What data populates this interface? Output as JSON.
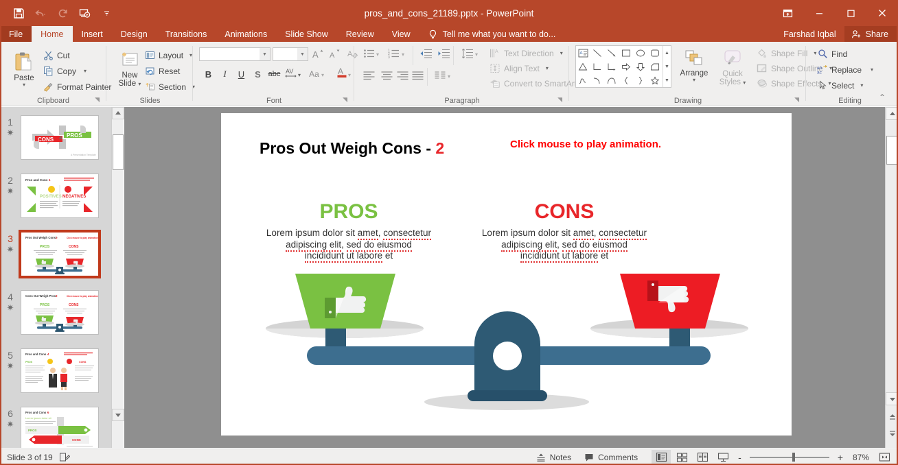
{
  "window": {
    "title": "pros_and_cons_21189.pptx - PowerPoint",
    "user": "Farshad Iqbal",
    "share_label": "Share",
    "qat": [
      {
        "name": "save-icon",
        "label": "Save"
      },
      {
        "name": "undo-icon",
        "label": "Undo"
      },
      {
        "name": "redo-icon",
        "label": "Redo"
      },
      {
        "name": "start-from-beginning-icon",
        "label": "Start From Beginning"
      },
      {
        "name": "customize-qat-icon",
        "label": "Customize Quick Access Toolbar"
      }
    ],
    "controls": [
      {
        "name": "ribbon-display-options",
        "label": "Ribbon Display Options"
      },
      {
        "name": "minimize",
        "label": "Minimize"
      },
      {
        "name": "restore",
        "label": "Restore Down"
      },
      {
        "name": "close",
        "label": "Close"
      }
    ]
  },
  "ribbon": {
    "tabs": [
      {
        "label": "File",
        "active": false,
        "file": true
      },
      {
        "label": "Home",
        "active": true,
        "file": false
      },
      {
        "label": "Insert",
        "active": false,
        "file": false
      },
      {
        "label": "Design",
        "active": false,
        "file": false
      },
      {
        "label": "Transitions",
        "active": false,
        "file": false
      },
      {
        "label": "Animations",
        "active": false,
        "file": false
      },
      {
        "label": "Slide Show",
        "active": false,
        "file": false
      },
      {
        "label": "Review",
        "active": false,
        "file": false
      },
      {
        "label": "View",
        "active": false,
        "file": false
      }
    ],
    "tellme": "Tell me what you want to do...",
    "groups": {
      "clipboard": {
        "label": "Clipboard",
        "paste": "Paste",
        "cut": "Cut",
        "copy": "Copy",
        "format_painter": "Format Painter"
      },
      "slides": {
        "label": "Slides",
        "new_slide": "New\nSlide",
        "new_slide_line1": "New",
        "new_slide_line2": "Slide",
        "layout": "Layout",
        "reset": "Reset",
        "section": "Section"
      },
      "font": {
        "label": "Font",
        "font_name_value": "",
        "font_size_value": "",
        "grow_font": "A",
        "shrink_font": "A",
        "clear_formatting": "Clear All Formatting",
        "bold": "B",
        "italic": "I",
        "underline": "U",
        "shadow": "S",
        "strikethrough": "abc",
        "character_spacing": "AV",
        "change_case": "Aa",
        "font_color": "A"
      },
      "paragraph": {
        "label": "Paragraph",
        "text_direction": "Text Direction",
        "align_text": "Align Text",
        "convert_to_smartart": "Convert to SmartArt"
      },
      "drawing": {
        "label": "Drawing",
        "arrange": "Arrange",
        "quick_styles_line1": "Quick",
        "quick_styles_line2": "Styles",
        "shape_fill": "Shape Fill",
        "shape_outline": "Shape Outline",
        "shape_effects": "Shape Effects"
      },
      "editing": {
        "label": "Editing",
        "find": "Find",
        "replace": "Replace",
        "select": "Select"
      }
    }
  },
  "thumbnails": [
    {
      "number": "1",
      "selected": false,
      "kind": "cover"
    },
    {
      "number": "2",
      "selected": false,
      "kind": "positives-negatives"
    },
    {
      "number": "3",
      "selected": true,
      "kind": "scale"
    },
    {
      "number": "4",
      "selected": false,
      "kind": "scale"
    },
    {
      "number": "5",
      "selected": false,
      "kind": "people"
    },
    {
      "number": "6",
      "selected": false,
      "kind": "arrows"
    }
  ],
  "slide": {
    "title_text": "Pros Out Weigh Cons - ",
    "title_number": "2",
    "animation_note": "Click mouse to play animation.",
    "columns": [
      {
        "heading": "PROS",
        "color": "#7ac142",
        "body_lines": [
          [
            {
              "t": "Lorem ipsum dolor sit ",
              "sq": false
            },
            {
              "t": "amet",
              "sq": true
            },
            {
              "t": ", ",
              "sq": false
            },
            {
              "t": "consectetur",
              "sq": true
            }
          ],
          [
            {
              "t": "adipiscing elit",
              "sq": true
            },
            {
              "t": ", ",
              "sq": false
            },
            {
              "t": "sed do eiusmod",
              "sq": true
            }
          ],
          [
            {
              "t": "incididunt ut labore",
              "sq": true
            },
            {
              "t": " et",
              "sq": false
            }
          ]
        ]
      },
      {
        "heading": "CONS",
        "color": "#e8262a",
        "body_lines": [
          [
            {
              "t": "Lorem ipsum dolor sit ",
              "sq": false
            },
            {
              "t": "amet",
              "sq": true
            },
            {
              "t": ", ",
              "sq": false
            },
            {
              "t": "consectetur",
              "sq": true
            }
          ],
          [
            {
              "t": "adipiscing elit",
              "sq": true
            },
            {
              "t": ", ",
              "sq": false
            },
            {
              "t": "sed do eiusmod",
              "sq": true
            }
          ],
          [
            {
              "t": "incididunt ut labore",
              "sq": true
            },
            {
              "t": " et",
              "sq": false
            }
          ]
        ]
      }
    ],
    "graphic": {
      "name": "balance-scale",
      "left_pan_color": "#7ac142",
      "right_pan_color": "#ed1c24",
      "beam_color": "#3d6e8f",
      "base_color": "#2e5a74",
      "pan_plate_color": "#d4d4d4",
      "thumb_icon_color": "#f1f2f2"
    }
  },
  "statusbar": {
    "slide_count": "Slide 3 of 19",
    "notes": "Notes",
    "comments": "Comments",
    "zoom_percent": "87%",
    "views": [
      {
        "name": "normal-view",
        "active": true
      },
      {
        "name": "slide-sorter-view",
        "active": false
      },
      {
        "name": "reading-view",
        "active": false
      },
      {
        "name": "slide-show-view",
        "active": false
      }
    ],
    "zoom_out": "-",
    "zoom_in": "+"
  },
  "colors": {
    "brand": "#b7472a",
    "ribbon_bg": "#f0efee",
    "accent_red": "#e8262a",
    "accent_green": "#7ac142"
  }
}
